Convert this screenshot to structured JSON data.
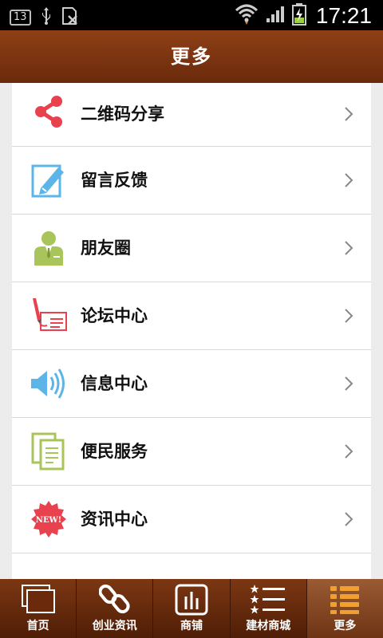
{
  "status_bar": {
    "badge": "13",
    "time": "17:21"
  },
  "header": {
    "title": "更多"
  },
  "menu": {
    "items": [
      {
        "label": "二维码分享",
        "icon": "share-icon"
      },
      {
        "label": "留言反馈",
        "icon": "edit-note-icon"
      },
      {
        "label": "朋友圈",
        "icon": "person-icon"
      },
      {
        "label": "论坛中心",
        "icon": "pen-paper-icon"
      },
      {
        "label": "信息中心",
        "icon": "speaker-icon"
      },
      {
        "label": "便民服务",
        "icon": "documents-icon"
      },
      {
        "label": "资讯中心",
        "icon": "new-badge-icon"
      }
    ],
    "new_badge_text": "NEW!"
  },
  "tabs": {
    "items": [
      {
        "label": "首页",
        "icon": "windows-icon"
      },
      {
        "label": "创业资讯",
        "icon": "link-icon"
      },
      {
        "label": "商铺",
        "icon": "bar-chart-icon"
      },
      {
        "label": "建材商城",
        "icon": "star-list-icon"
      },
      {
        "label": "更多",
        "icon": "menu-list-icon"
      }
    ],
    "active_index": 4
  },
  "colors": {
    "header": "#7a3310",
    "share": "#e8424f",
    "accent_blue": "#5bb5e8",
    "accent_green": "#a8c45a"
  }
}
